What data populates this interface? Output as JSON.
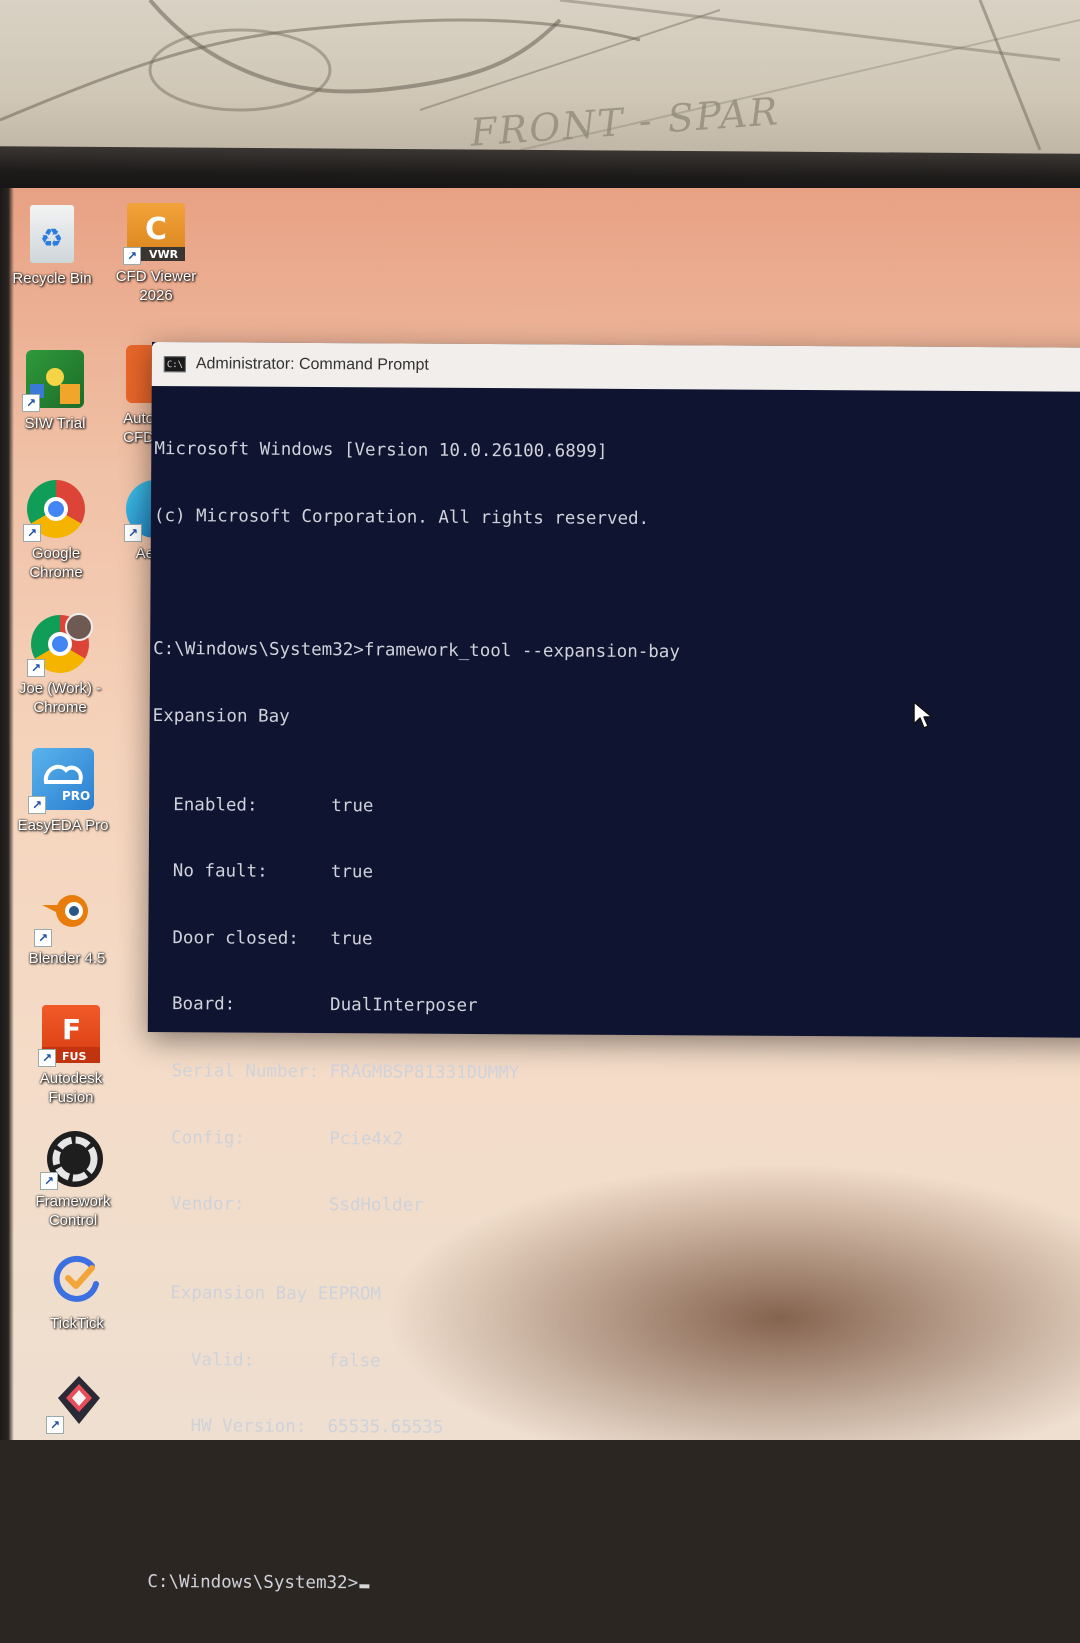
{
  "paper": {
    "handwriting": "FRONT - SPAR"
  },
  "desktop": {
    "icons": [
      {
        "label": "Recycle Bin",
        "icon": "recycle-bin-icon"
      },
      {
        "label": "CFD Viewer\n2026",
        "icon": "cfd-viewer-icon",
        "badge": "VWR",
        "glyph": "C"
      },
      {
        "label": "SIW Trial",
        "icon": "siw-trial-icon"
      },
      {
        "label": "Auto\nCFD",
        "icon": "autodesk-cfd-icon"
      },
      {
        "label": "Google\nChrome",
        "icon": "chrome-icon"
      },
      {
        "label": "Ae",
        "icon": "edge-icon"
      },
      {
        "label": "Joe (Work) -\nChrome",
        "icon": "chrome-profile-icon"
      },
      {
        "label": "EasyEDA Pro",
        "icon": "easyeda-icon",
        "badge": "PRO"
      },
      {
        "label": "Blender 4.5",
        "icon": "blender-icon"
      },
      {
        "label": "Autodesk\nFusion",
        "icon": "fusion-icon",
        "badge": "FUS",
        "glyph": "F"
      },
      {
        "label": "Framework\nControl",
        "icon": "framework-control-icon"
      },
      {
        "label": "TickTick",
        "icon": "ticktick-icon"
      },
      {
        "label": "",
        "icon": "app-icon"
      }
    ]
  },
  "cmd": {
    "title": "Administrator: Command Prompt",
    "banner_1": "Microsoft Windows [Version 10.0.26100.6899]",
    "banner_2": "(c) Microsoft Corporation. All rights reserved.",
    "command": "C:\\Windows\\System32>framework_tool --expansion-bay",
    "section": "Expansion Bay",
    "fields": [
      {
        "key": "  Enabled:       ",
        "value": "true"
      },
      {
        "key": "  No fault:      ",
        "value": "true"
      },
      {
        "key": "  Door closed:   ",
        "value": "true"
      },
      {
        "key": "  Board:         ",
        "value": "DualInterposer"
      },
      {
        "key": "  Serial Number: ",
        "value": "FRAGMBSP81331DUMMY"
      },
      {
        "key": "  Config:        ",
        "value": "Pcie4x2"
      },
      {
        "key": "  Vendor:        ",
        "value": "SsdHolder"
      }
    ],
    "eeprom_header": "  Expansion Bay EEPROM",
    "eeprom_fields": [
      {
        "key": "    Valid:       ",
        "value": "false"
      },
      {
        "key": "    HW Version:  ",
        "value": "65535.65535"
      }
    ],
    "prompt": "C:\\Windows\\System32>"
  },
  "colors": {
    "console_bg": "#0f1531",
    "console_text": "#cfd2da"
  }
}
